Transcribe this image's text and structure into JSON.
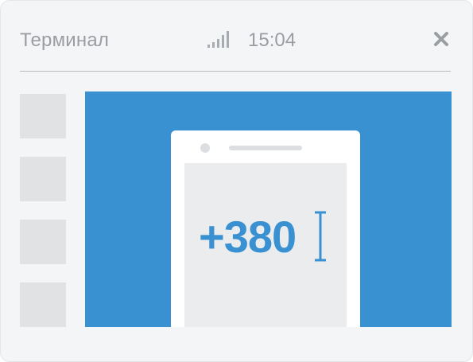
{
  "header": {
    "title": "Терминал",
    "time": "15:04",
    "signal_icon": "signal-strength-icon",
    "close_icon": "close-icon"
  },
  "sidebar": {
    "thumbnails": [
      {
        "icon": "placeholder-thumbnail"
      },
      {
        "icon": "placeholder-thumbnail"
      },
      {
        "icon": "placeholder-thumbnail"
      },
      {
        "icon": "placeholder-thumbnail"
      }
    ]
  },
  "main": {
    "phone": {
      "input_value": "+380",
      "cursor_icon": "text-cursor-icon"
    }
  },
  "colors": {
    "accent": "#3991d2",
    "text_muted": "#9a9da2",
    "background": "#f4f5f7",
    "placeholder": "#e1e2e4",
    "phone_screen": "#ebecee"
  }
}
